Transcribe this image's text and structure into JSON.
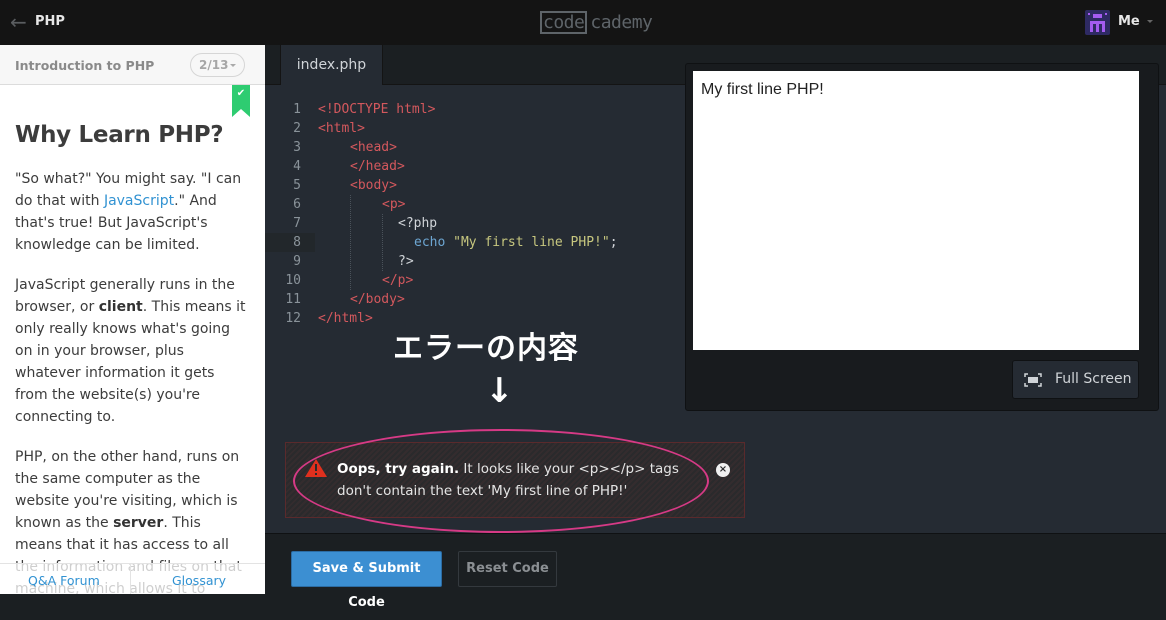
{
  "topbar": {
    "course_title": "PHP",
    "logo_boxed": "code",
    "logo_rest": "cademy",
    "user_label": "Me"
  },
  "lesson": {
    "section_title": "Introduction to PHP",
    "pager": "2/13",
    "completed_mark": "✔",
    "heading": "Why Learn PHP?",
    "p1": {
      "before": "\"So what?\" You might say. \"I can do that with ",
      "link": "JavaScript",
      "after": ".\" And that's true! But JavaScript's knowledge can be limited."
    },
    "p2": {
      "before": "JavaScript generally runs in the browser, or ",
      "bold": "client",
      "after": ". This means it only really knows what's going on in your browser, plus whatever information it gets from the website(s) you're connecting to."
    },
    "p3": {
      "before": "PHP, on the other hand, runs on the same computer as the website you're visiting, which is known as the ",
      "bold": "server",
      "after": ". This means that it has access to all the information and files on that machine, which allows it to"
    },
    "footer": {
      "qa_forum": "Q&A Forum",
      "glossary": "Glossary"
    }
  },
  "editor": {
    "tab": "index.php",
    "line_numbers": [
      "1",
      "2",
      "3",
      "4",
      "5",
      "6",
      "7",
      "8",
      "9",
      "10",
      "11",
      "12"
    ],
    "lines": {
      "l1": "<!DOCTYPE html>",
      "l2": "<html>",
      "l3": "<head>",
      "l4": "</head>",
      "l5": "<body>",
      "l6": "<p>",
      "l7": "<?php",
      "l8_kw": "echo",
      "l8_str": "\"My first line PHP!\"",
      "l8_end": ";",
      "l9": "?>",
      "l10": "</p>",
      "l11": "</body>",
      "l12": "</html>"
    }
  },
  "annotation": {
    "label": "エラーの内容",
    "arrow": "↓"
  },
  "error": {
    "title": "Oops, try again.",
    "message": " It looks like your <p></p> tags don't contain the text 'My first line of PHP!'",
    "close": "×"
  },
  "preview": {
    "output": "My first line PHP!",
    "fullscreen_label": "Full Screen"
  },
  "actions": {
    "submit": "Save & Submit Code",
    "reset": "Reset Code"
  },
  "colors": {
    "accent_blue": "#3c8fd2",
    "success_green": "#2ecc71",
    "error_red": "#e0301e",
    "annotation_pink": "#d63a86"
  }
}
